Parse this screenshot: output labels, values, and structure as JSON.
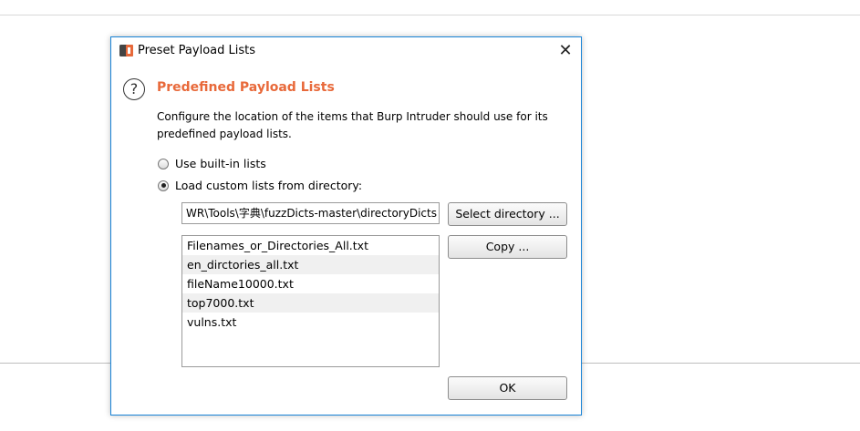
{
  "dialog": {
    "title": "Preset Payload Lists",
    "close_glyph": "✕",
    "heading": "Predefined Payload Lists",
    "description": "Configure the location of the items that Burp Intruder should use for its predefined payload lists.",
    "help_glyph": "?",
    "radios": {
      "builtin_label": "Use built-in lists",
      "custom_label": "Load custom lists from directory:",
      "selected": "custom"
    },
    "directory_path": "WR\\Tools\\字典\\fuzzDicts-master\\directoryDicts",
    "select_directory_label": "Select directory ...",
    "copy_label": "Copy ...",
    "ok_label": "OK",
    "files": [
      "Filenames_or_Directories_All.txt",
      "en_dirctories_all.txt",
      "fileName10000.txt",
      "top7000.txt",
      "vulns.txt"
    ],
    "colors": {
      "heading": "#e8693a",
      "border": "#1883d7",
      "app_icon_dark": "#444444",
      "app_icon_orange": "#e8693a"
    }
  }
}
